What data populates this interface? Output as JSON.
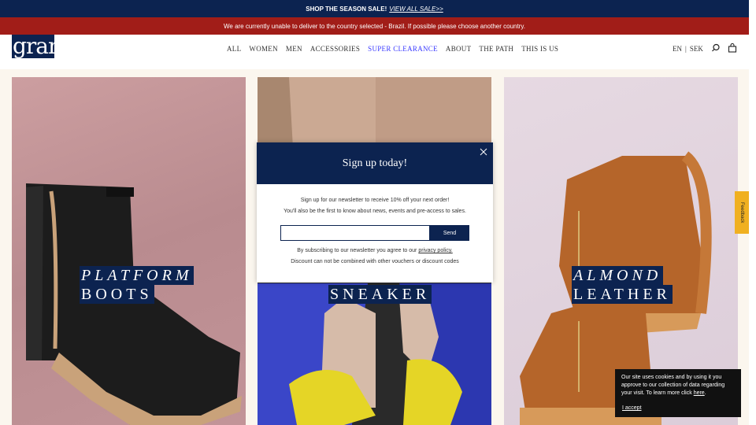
{
  "promo": {
    "text": "SHOP THE SEASON SALE!",
    "link": "VIEW ALL SALE>>"
  },
  "alert": {
    "text": "We are currently unable to deliver to the country selected - Brazil. If possible please choose another country."
  },
  "header": {
    "logo": "gram",
    "nav": [
      "ALL",
      "WOMEN",
      "MEN",
      "ACCESSORIES",
      "SUPER CLEARANCE",
      "ABOUT",
      "THE PATH",
      "THIS IS US"
    ],
    "lang": "EN",
    "separator": "|",
    "currency": "SEK"
  },
  "tiles": [
    {
      "line1": "PLATFORM",
      "line2": "BOOTS"
    },
    {
      "line1": "",
      "line2": "SNEAKER"
    },
    {
      "line1": "ALMOND",
      "line2": "LEATHER"
    }
  ],
  "modal": {
    "title": "Sign up today!",
    "line1": "Sign up for our newsletter to receive 10% off your next order!",
    "line2": "You'll also be the first to know about news, events and pre-access to sales.",
    "email_placeholder": "",
    "send_label": "Send",
    "privacy_prefix": "By subscribing to our newsletter you agree to our",
    "privacy_link": "privacy policy.",
    "discount_note": "Discount can not be combined with other vouchers or discount codes"
  },
  "feedback": {
    "label": "Feedback"
  },
  "cookie": {
    "text": "Our site uses cookies and by using it you approve to our collection of data regarding your visit. To learn more click",
    "link": "here",
    "end": ".",
    "accept": "I accept"
  }
}
